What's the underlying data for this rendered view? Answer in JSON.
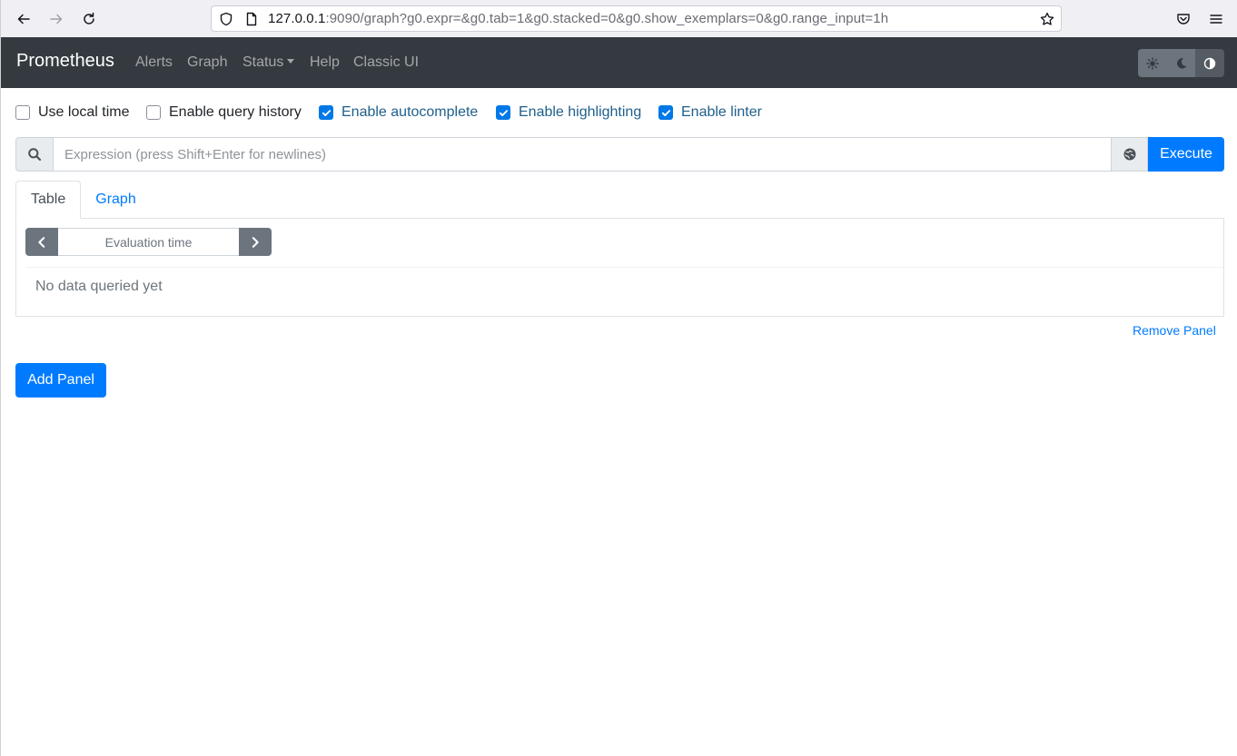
{
  "browser": {
    "url_host": "127.0.0.1",
    "url_rest": ":9090/graph?g0.expr=&g0.tab=1&g0.stacked=0&g0.show_exemplars=0&g0.range_input=1h",
    "icons": [
      "back-arrow-icon",
      "forward-arrow-icon",
      "reload-icon",
      "shield-icon",
      "page-icon",
      "star-icon",
      "pocket-icon",
      "hamburger-menu-icon"
    ]
  },
  "navbar": {
    "brand": "Prometheus",
    "links": {
      "alerts": "Alerts",
      "graph": "Graph",
      "status": "Status",
      "help": "Help",
      "classic": "Classic UI"
    },
    "theme_icons": [
      "sun-icon",
      "moon-icon",
      "half-circle-icon"
    ]
  },
  "options": {
    "local_time": {
      "label": "Use local time",
      "checked": false
    },
    "query_history": {
      "label": "Enable query history",
      "checked": false
    },
    "autocomplete": {
      "label": "Enable autocomplete",
      "checked": true
    },
    "highlighting": {
      "label": "Enable highlighting",
      "checked": true
    },
    "linter": {
      "label": "Enable linter",
      "checked": true
    }
  },
  "expression": {
    "placeholder": "Expression (press Shift+Enter for newlines)",
    "value": "",
    "execute_label": "Execute"
  },
  "panel": {
    "tabs": {
      "table": "Table",
      "graph": "Graph"
    },
    "active_tab": "Table",
    "eval_placeholder": "Evaluation time",
    "no_data": "No data queried yet",
    "remove_label": "Remove Panel"
  },
  "add_panel_label": "Add Panel",
  "colors": {
    "navbar_bg": "#343a40",
    "primary": "#007bff",
    "secondary": "#6c757d"
  }
}
